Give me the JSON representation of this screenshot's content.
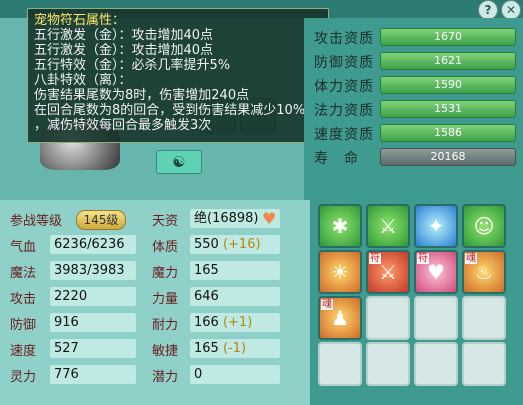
{
  "top_buttons": {
    "help": "?",
    "close": "✕"
  },
  "tooltip": {
    "title": "宠物符石属性：",
    "lines": [
      "五行激发（金）：攻击增加40点",
      "五行激发（金）：攻击增加40点",
      "五行特效（金）：必杀几率提升5%",
      "八卦特效（离）：",
      "伤害结果尾数为8时，伤害增加240点",
      "在回合尾数为8的回合，受到伤害结果减少10%",
      "，减伤特效每回合最多触发3次"
    ]
  },
  "pet_panel": {
    "yinyang_button": "☯"
  },
  "aptitudes": [
    {
      "label": "攻击资质",
      "value": "1670",
      "color": "green"
    },
    {
      "label": "防御资质",
      "value": "1621",
      "color": "green"
    },
    {
      "label": "体力资质",
      "value": "1590",
      "color": "green"
    },
    {
      "label": "法力资质",
      "value": "1531",
      "color": "green"
    },
    {
      "label": "速度资质",
      "value": "1586",
      "color": "green"
    },
    {
      "label": "寿　命",
      "value": "20168",
      "color": "gray"
    }
  ],
  "stats": {
    "level_label": "参战等级",
    "level_value": "145级",
    "talent_label": "天资",
    "talent_value": "绝(16898)",
    "rows": [
      {
        "l1": "气血",
        "v1": "6236/6236",
        "l2": "体质",
        "v2": "550",
        "b2": "(+16)"
      },
      {
        "l1": "魔法",
        "v1": "3983/3983",
        "l2": "魔力",
        "v2": "165",
        "b2": ""
      },
      {
        "l1": "攻击",
        "v1": "2220",
        "l2": "力量",
        "v2": "646",
        "b2": ""
      },
      {
        "l1": "防御",
        "v1": "916",
        "l2": "耐力",
        "v2": "166",
        "b2": "(+1)"
      },
      {
        "l1": "速度",
        "v1": "527",
        "l2": "敏捷",
        "v2": "165",
        "b2": "(-1)"
      },
      {
        "l1": "灵力",
        "v1": "776",
        "l2": "潜力",
        "v2": "0",
        "b2": ""
      }
    ]
  },
  "skills": [
    {
      "tag": "",
      "glyph": "✱"
    },
    {
      "tag": "",
      "glyph": "⚔"
    },
    {
      "tag": "",
      "glyph": "✦"
    },
    {
      "tag": "",
      "glyph": "☺"
    },
    {
      "tag": "",
      "glyph": "☀"
    },
    {
      "tag": "符",
      "glyph": "⚔"
    },
    {
      "tag": "符",
      "glyph": "♥"
    },
    {
      "tag": "魂",
      "glyph": "♨"
    },
    {
      "tag": "魂",
      "glyph": "♟"
    }
  ]
}
